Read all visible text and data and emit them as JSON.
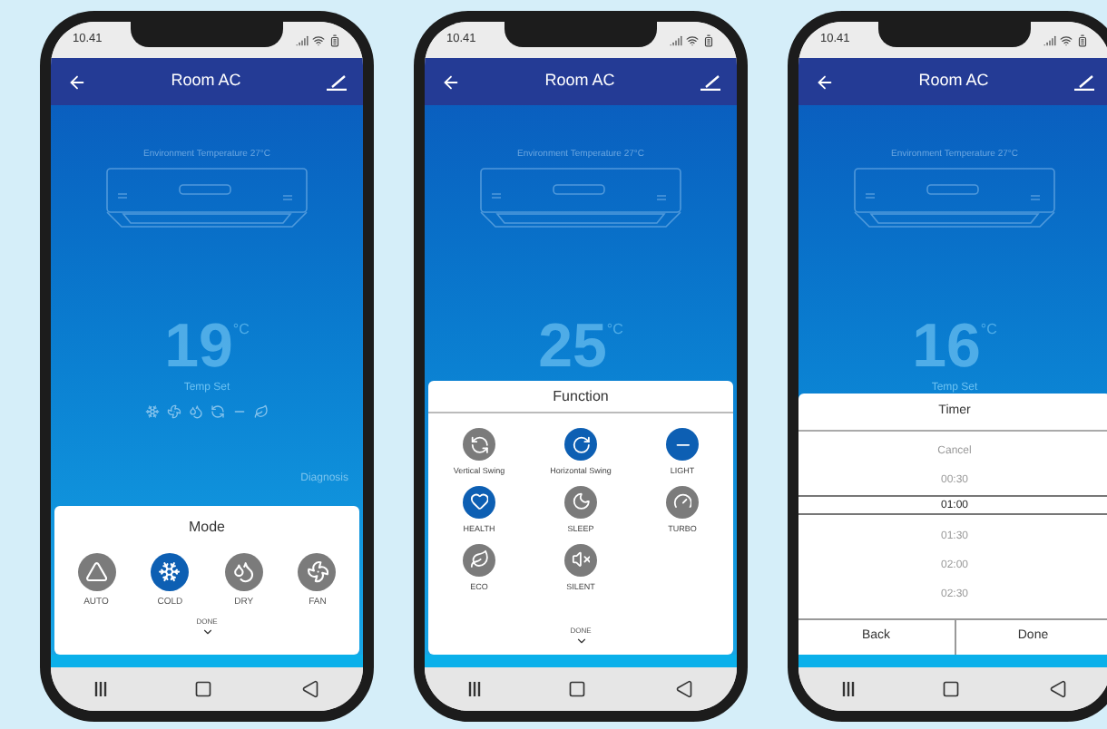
{
  "phones": [
    {
      "status_time": "10.41",
      "title": "Room AC",
      "environment": "Environment Temperature 27°C",
      "temperature": "19",
      "unit": "°C",
      "temp_label": "Temp Set",
      "status_icons": true,
      "diagnosis": "Diagnosis",
      "sheet": {
        "kind": "mode",
        "title": "Mode",
        "done": "DONE",
        "options": [
          {
            "kind": "auto",
            "label": "AUTO",
            "selected": false
          },
          {
            "kind": "cold",
            "label": "COLD",
            "selected": true
          },
          {
            "kind": "dry",
            "label": "DRY",
            "selected": false
          },
          {
            "kind": "fan",
            "label": "FAN",
            "selected": false
          }
        ]
      }
    },
    {
      "status_time": "10.41",
      "title": "Room AC",
      "environment": "Environment Temperature 27°C",
      "temperature": "25",
      "unit": "°C",
      "sheet": {
        "kind": "function",
        "title": "Function",
        "done": "DONE",
        "options": [
          {
            "kind": "vertical",
            "label": "Vertical Swing",
            "selected": false
          },
          {
            "kind": "horizontal",
            "label": "Horizontal Swing",
            "selected": true
          },
          {
            "kind": "light",
            "label": "LIGHT",
            "selected": true
          },
          {
            "kind": "health",
            "label": "HEALTH",
            "selected": true
          },
          {
            "kind": "sleep",
            "label": "SLEEP",
            "selected": false
          },
          {
            "kind": "turbo",
            "label": "TURBO",
            "selected": false
          },
          {
            "kind": "eco",
            "label": "ECO",
            "selected": false
          },
          {
            "kind": "silent",
            "label": "SILENT",
            "selected": false
          }
        ]
      }
    },
    {
      "status_time": "10.41",
      "title": "Room AC",
      "environment": "Environment Temperature 27°C",
      "temperature": "16",
      "unit": "°C",
      "temp_label": "Temp Set",
      "sheet": {
        "kind": "timer",
        "title": "Timer",
        "options": [
          {
            "label": "Cancel",
            "selected": false
          },
          {
            "label": "00:30",
            "selected": false
          },
          {
            "label": "01:00",
            "selected": true
          },
          {
            "label": "01:30",
            "selected": false
          },
          {
            "label": "02:00",
            "selected": false
          },
          {
            "label": "02:30",
            "selected": false
          }
        ],
        "buttons": [
          "Back",
          "Done"
        ]
      }
    }
  ]
}
